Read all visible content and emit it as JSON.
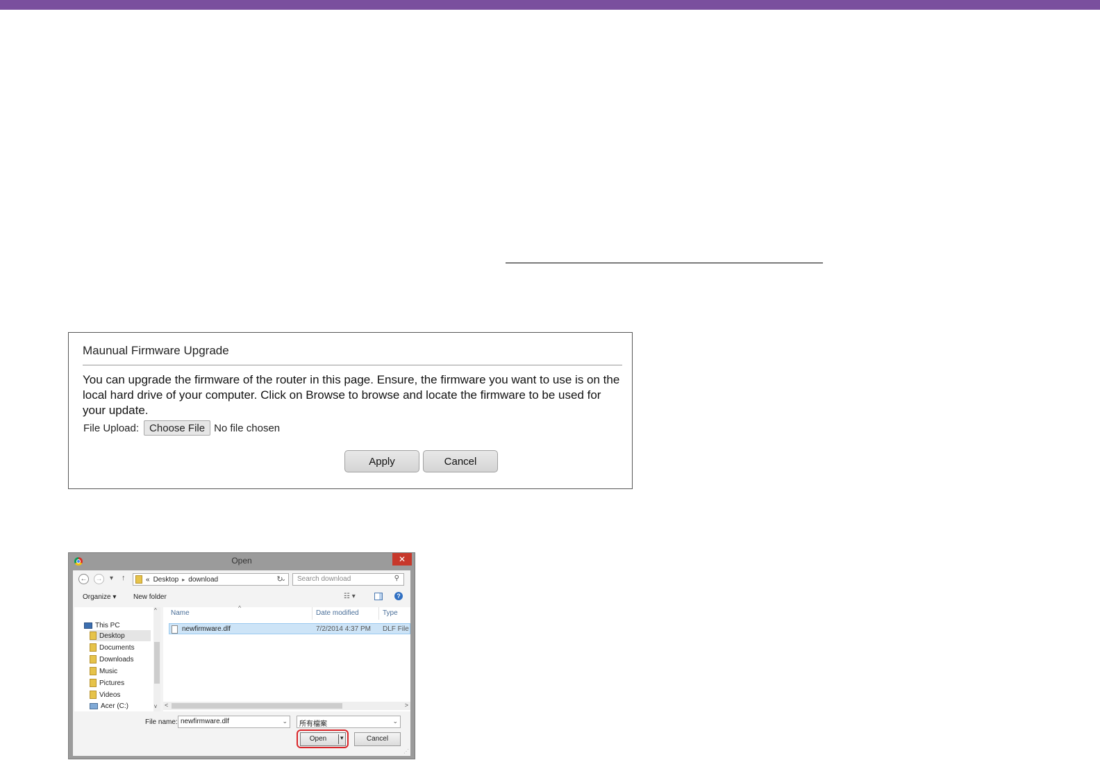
{
  "colors": {
    "top_bar": "#7a4f9e",
    "highlight": "#d9262a"
  },
  "firmware_panel": {
    "title": "Maunual Firmware Upgrade",
    "description": "You can upgrade the firmware of the router in this page. Ensure, the firmware you want to use is on the local hard drive of your computer. Click on Browse to browse and locate the firmware to be used for your update.",
    "file_upload_label": "File Upload:",
    "choose_file_label": "Choose File",
    "no_file_text": "No file chosen",
    "apply_label": "Apply",
    "cancel_label": "Cancel"
  },
  "open_dialog": {
    "title": "Open",
    "close_glyph": "✕",
    "nav": {
      "back": "←",
      "forward": "→",
      "up": "↑"
    },
    "address": {
      "prefix": "«",
      "crumbs": [
        "Desktop",
        "download"
      ],
      "separator": "▸"
    },
    "search_placeholder": "Search download",
    "toolbar": {
      "organize": "Organize ▾",
      "new_folder": "New folder"
    },
    "nav_items": [
      {
        "label": "This PC",
        "icon": "computer-icon"
      },
      {
        "label": "Desktop",
        "icon": "folder-icon",
        "selected": true
      },
      {
        "label": "Documents",
        "icon": "folder-icon"
      },
      {
        "label": "Downloads",
        "icon": "folder-icon"
      },
      {
        "label": "Music",
        "icon": "folder-icon"
      },
      {
        "label": "Pictures",
        "icon": "folder-icon"
      },
      {
        "label": "Videos",
        "icon": "folder-icon"
      },
      {
        "label": "Acer (C:)",
        "icon": "drive-icon"
      }
    ],
    "columns": {
      "name": "Name",
      "date": "Date modified",
      "type": "Type"
    },
    "file": {
      "name": "newfirmware.dlf",
      "date": "7/2/2014 4:37 PM",
      "type": "DLF File"
    },
    "file_name_label": "File name:",
    "file_name_value": "newfirmware.dlf",
    "file_type_value": "所有檔案",
    "open_label": "Open",
    "cancel_label": "Cancel"
  }
}
